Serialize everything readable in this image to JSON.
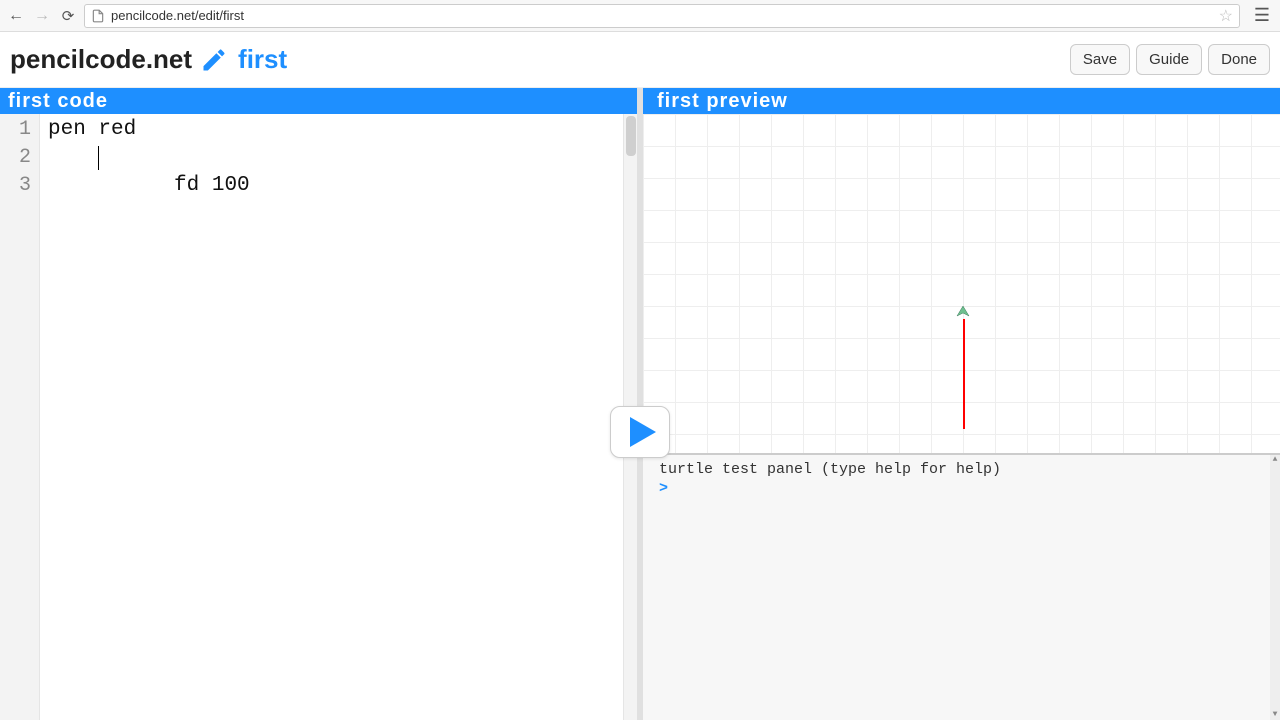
{
  "browser": {
    "url": "pencilcode.net/edit/first"
  },
  "header": {
    "brand": "pencilcode.net",
    "filename": "first",
    "buttons": {
      "save": "Save",
      "guide": "Guide",
      "done": "Done"
    }
  },
  "panels": {
    "code_title": "first code",
    "preview_title": "first preview"
  },
  "code": {
    "lines": [
      "pen red",
      "fd 100",
      ""
    ],
    "cursor": {
      "line": 2,
      "col": 4
    }
  },
  "console": {
    "message": "turtle test panel (type help for help)",
    "prompt": ">"
  },
  "colors": {
    "accent": "#1e8fff",
    "pen": "red"
  }
}
